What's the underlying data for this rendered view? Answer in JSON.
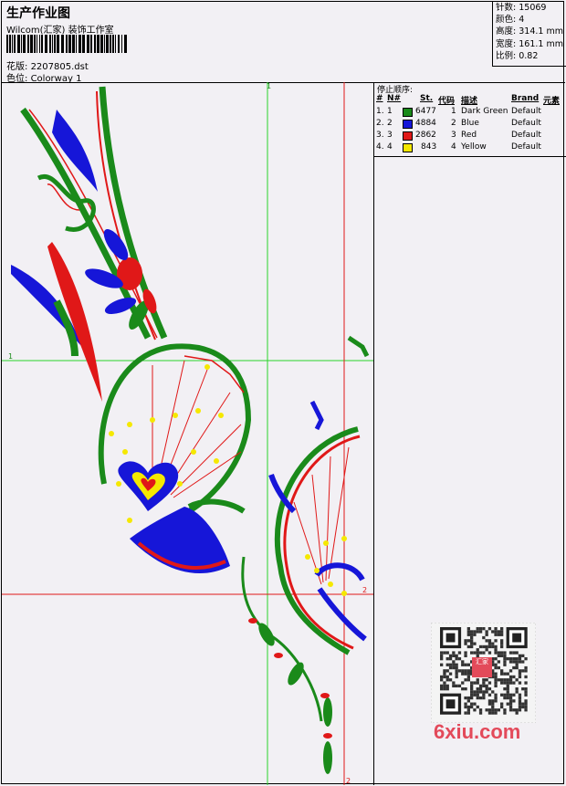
{
  "header": {
    "title": "生产作业图",
    "company": "Wilcom(汇家) 装饰工作室",
    "design_label": "花版:",
    "design_value": "2207805.dst",
    "colorway_label": "色位:",
    "colorway_value": "Colorway 1"
  },
  "stats": [
    {
      "label": "针数:",
      "value": "15069"
    },
    {
      "label": "颜色:",
      "value": "4"
    },
    {
      "label": "高度:",
      "value": "314.1 mm"
    },
    {
      "label": "宽度:",
      "value": "161.1 mm"
    },
    {
      "label": "比例:",
      "value": "0.82"
    }
  ],
  "stop_sequence": {
    "title": "停止顺序:",
    "columns": [
      "#",
      "N#",
      "St.",
      "代码",
      "描述",
      "Brand",
      "元素"
    ],
    "rows": [
      {
        "idx": "1.",
        "n": "1",
        "color": "#1a8a1a",
        "st": "6477",
        "code": "1",
        "desc": "Dark Green",
        "brand": "Default"
      },
      {
        "idx": "2.",
        "n": "2",
        "color": "#1616d8",
        "st": "4884",
        "code": "2",
        "desc": "Blue",
        "brand": "Default"
      },
      {
        "idx": "3.",
        "n": "3",
        "color": "#e01818",
        "st": "2862",
        "code": "3",
        "desc": "Red",
        "brand": "Default"
      },
      {
        "idx": "4.",
        "n": "4",
        "color": "#f5e800",
        "st": "843",
        "code": "4",
        "desc": "Yellow",
        "brand": "Default"
      }
    ]
  },
  "guides": {
    "green_top": "1",
    "green_left": "1",
    "red_right": "2",
    "red_bottom": "2"
  },
  "qr": {
    "stamp_text": "汇家"
  },
  "watermark": "6xiu.com",
  "colors": {
    "green": "#1a8a1a",
    "blue": "#1616d8",
    "red": "#e01818",
    "yellow": "#f5e800",
    "background": "#f2f0f4"
  }
}
